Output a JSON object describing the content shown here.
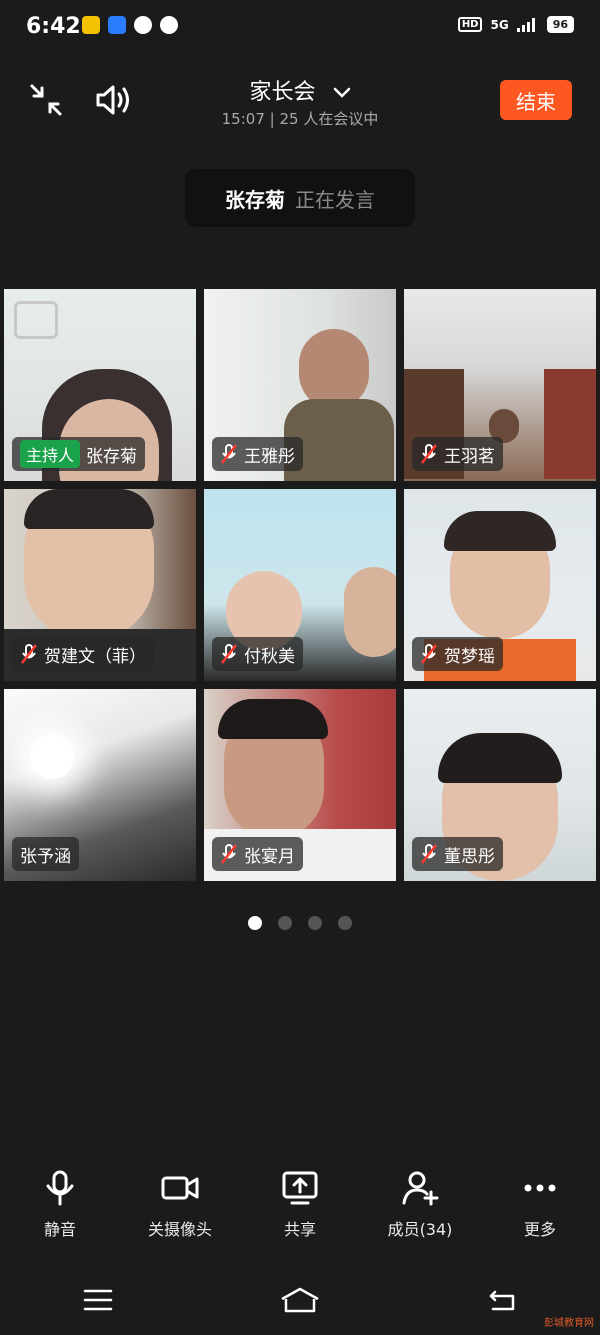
{
  "status_bar": {
    "time": "6:42",
    "network": "5G",
    "battery": "96",
    "hd": "HD"
  },
  "header": {
    "title": "家长会",
    "subtitle_time": "15:07",
    "subtitle_count": "25 人在会议中",
    "end_label": "结束"
  },
  "speaker": {
    "name": "张存菊",
    "status": "正在发言"
  },
  "participants": [
    {
      "name": "张存菊",
      "badge": "主持人",
      "muted": false
    },
    {
      "name": "王雅彤",
      "muted": true
    },
    {
      "name": "王羽茗",
      "muted": true
    },
    {
      "name": "贺建文（菲）",
      "muted": true
    },
    {
      "name": "付秋美",
      "muted": true
    },
    {
      "name": "贺梦瑶",
      "muted": true
    },
    {
      "name": "张予涵",
      "muted": false
    },
    {
      "name": "张宴月",
      "muted": true
    },
    {
      "name": "董思彤",
      "muted": true
    }
  ],
  "pager": {
    "pages": 4,
    "current": 1
  },
  "toolbar": {
    "mute_label": "静音",
    "camera_label": "关摄像头",
    "share_label": "共享",
    "members_label": "成员(34)",
    "more_label": "更多"
  },
  "watermark": "彭城教育网"
}
